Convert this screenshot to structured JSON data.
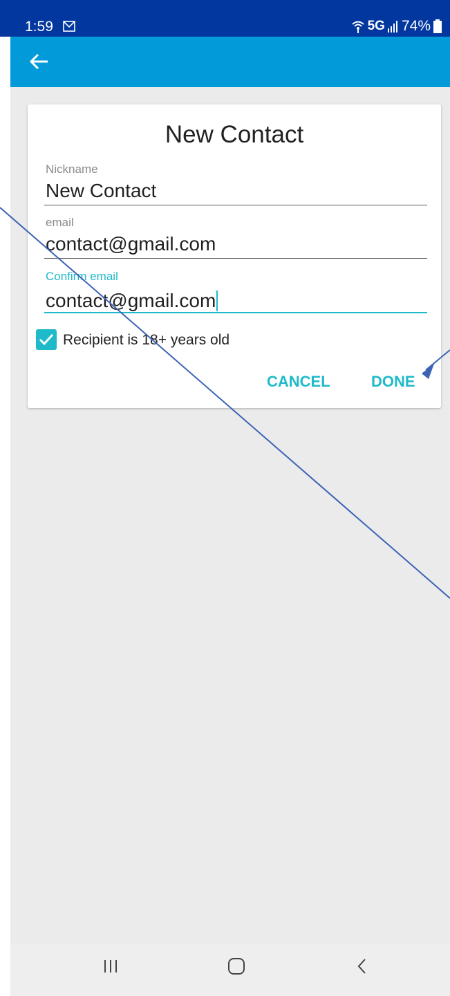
{
  "status_bar": {
    "time": "1:59",
    "network": "5G",
    "battery": "74%",
    "icons": [
      "mail-icon",
      "wifi-calling-icon",
      "signal-icon",
      "battery-icon"
    ]
  },
  "app_bar": {
    "back_icon": "arrow-left-icon",
    "color": "#039ad9"
  },
  "dialog": {
    "title": "New Contact",
    "fields": [
      {
        "label": "Nickname",
        "value": "New Contact"
      },
      {
        "label": "email",
        "value": "contact@gmail.com"
      },
      {
        "label": "Confirm email",
        "value": "contact@gmail.com",
        "focused": true
      }
    ],
    "checkbox": {
      "label": "Recipient is 18+ years old",
      "checked": true
    },
    "buttons": {
      "cancel": "CANCEL",
      "done": "DONE"
    }
  },
  "nav_bar": {
    "icons": [
      "recent-apps-icon",
      "home-icon",
      "back-icon"
    ]
  },
  "colors": {
    "status_bar": "#0237a0",
    "accent": "#1fbac9",
    "background": "#ebebeb"
  }
}
